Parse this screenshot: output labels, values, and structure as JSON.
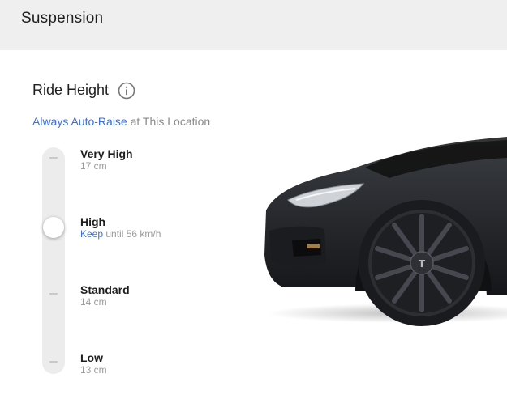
{
  "header": {
    "title": "Suspension"
  },
  "ride_height": {
    "title": "Ride Height",
    "info_icon": "info-circle-icon",
    "auto_raise": {
      "link": "Always Auto-Raise",
      "rest": " at This Location"
    },
    "current_level_index": 1,
    "levels": [
      {
        "label": "Very High",
        "sub": "17 cm"
      },
      {
        "label": "High",
        "keep": "Keep",
        "sub_rest": " until 56 km/h"
      },
      {
        "label": "Standard",
        "sub": "14 cm"
      },
      {
        "label": "Low",
        "sub": "13 cm"
      }
    ]
  },
  "colors": {
    "accent": "#3b6fd6",
    "header_bg": "#efefef",
    "car_body": "#2a2c2f"
  }
}
